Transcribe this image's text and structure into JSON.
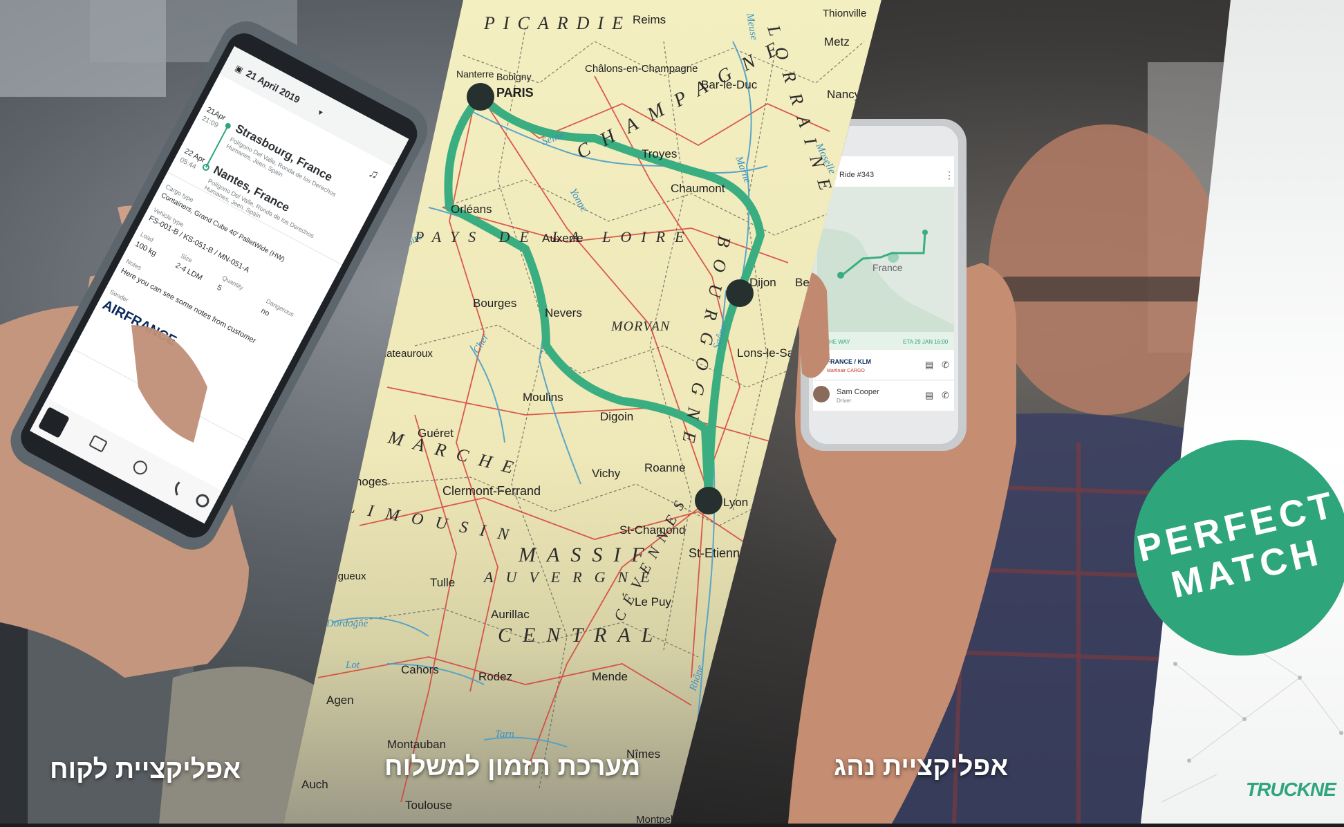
{
  "captions": {
    "customer": "אפליקציית לקוח",
    "booking": "מערכת תזמון למשלוח",
    "driver": "אפליקציית נהג"
  },
  "badge": {
    "line1": "PERFECT",
    "line2": "MATCH",
    "color": "#2fa57c"
  },
  "brand": {
    "logo": "TRUCKNE"
  },
  "customer_app": {
    "date": "21 April 2019",
    "stops": [
      {
        "date": "21Apr",
        "time": "21:09",
        "city": "Strasbourg, France",
        "address": "Polígono Del Valle, Ronda de los Derechos",
        "address2": "Humanes, Jeen, Spain"
      },
      {
        "date": "22 Apr",
        "time": "05:44",
        "city": "Nantes, France",
        "address": "Polígono Del Valle, Ronda de los Derechos",
        "address2": "Humanes, Jeen, Spain"
      }
    ],
    "cargo_type_label": "Cargo type",
    "cargo_type": "Containers, Grand Cube 40' PalletWide (HW)",
    "vehicle_type_label": "Vehicle type",
    "vehicle_type": "FS-001-B / KS-051-B / MN-051-A",
    "load_label": "Load",
    "load": "100 kg",
    "size_label": "Size",
    "size": "2-4 LDM",
    "quantity_label": "Quantity",
    "quantity": "5",
    "dangerous_label": "Dangerous",
    "dangerous": "no",
    "notes_label": "Notes",
    "notes": "Here you can see some notes from customer",
    "sender_label": "Sender",
    "sender_logo": "AIRFRANCE"
  },
  "driver_app": {
    "title": "Ride #343",
    "map_label": "France",
    "status": "ON THE WAY",
    "eta": "ETA 29 JAN 16:00",
    "carrier": "AIRFRANCE / KLM",
    "carrier_sub": "Martinair CARGO",
    "contact_name": "Sam Cooper",
    "contact_role": "Driver"
  },
  "map": {
    "route_color": "#3aae80",
    "region_labels": [
      "PICARDIE",
      "CHAMPAGNE",
      "LORRAINE",
      "BOURGOGNE",
      "MORVAN",
      "MARCHE",
      "LIMOUSIN",
      "MASSIF",
      "AUVERGNE",
      "CENTRAL",
      "CÉVENNES",
      "PAYS DE LA LOIRE"
    ],
    "cities": [
      "Reims",
      "Thionville",
      "Metz",
      "Châlons-en-Champagne",
      "Bobigny",
      "PARIS",
      "Nanterre",
      "Bar-le-Duc",
      "Nancy",
      "Troyes",
      "Chaumont",
      "Orléans",
      "Auxerre",
      "Dijon",
      "Bourges",
      "Nevers",
      "Lons-le-Saunier",
      "Chateauroux",
      "Moulins",
      "Digoin",
      "Guéret",
      "Vichy",
      "Roanne",
      "Lyon",
      "Clermont-Ferrand",
      "Limoges",
      "St-Chamond",
      "St-Etienne",
      "Périgueux",
      "Tulle",
      "Le Puy",
      "Aurillac",
      "Cahors",
      "Rodez",
      "Mende",
      "Agen",
      "Montauban",
      "Nîmes",
      "Auch",
      "Toulouse",
      "Montpellier",
      "Besançon"
    ],
    "rivers": [
      "Seine",
      "Yonne",
      "Loire",
      "Cher",
      "Marne",
      "Meuse",
      "Moselle",
      "Saône",
      "Rhône",
      "Dordogne",
      "Lot",
      "Tarn"
    ]
  }
}
